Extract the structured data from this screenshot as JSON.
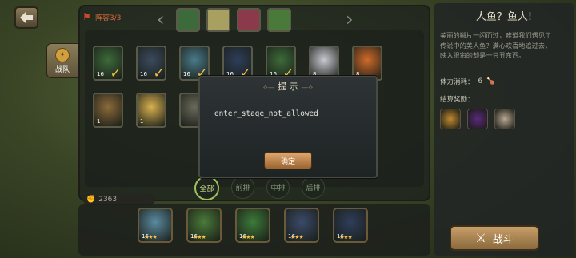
{
  "header": {
    "formation_label": "阵容3/3",
    "prev_icon": "chevron-left-icon",
    "next_icon": "chevron-right-icon"
  },
  "team_tab": {
    "label": "战队"
  },
  "hero_grid": {
    "row1": [
      {
        "level": "16",
        "selected": true,
        "color": "#3d6a3a"
      },
      {
        "level": "16",
        "selected": true,
        "color": "#3a4a5e"
      },
      {
        "level": "16",
        "selected": true,
        "color": "#4a7a8a"
      },
      {
        "level": "16",
        "selected": true,
        "color": "#2e3e5a"
      },
      {
        "level": "16",
        "selected": true,
        "color": "#3d6a3a"
      },
      {
        "level": "8",
        "selected": false,
        "color": "#c8c8d0"
      },
      {
        "level": "8",
        "selected": false,
        "color": "#d06a2a"
      }
    ],
    "row2": [
      {
        "level": "1",
        "selected": false,
        "color": "#8a6a3a"
      },
      {
        "level": "1",
        "selected": false,
        "color": "#d8b050"
      },
      {
        "level": "",
        "selected": false,
        "color": "#6a6a5a"
      }
    ]
  },
  "filters": [
    {
      "label": "全部",
      "active": true
    },
    {
      "label": "前排",
      "active": false
    },
    {
      "label": "中排",
      "active": false
    },
    {
      "label": "后排",
      "active": false
    }
  ],
  "power": {
    "value": "2363"
  },
  "bottom_team": [
    {
      "level": "16",
      "color": "#5a8aa0"
    },
    {
      "level": "16",
      "color": "#4a7a3a"
    },
    {
      "level": "16",
      "color": "#3d7a3a"
    },
    {
      "level": "16",
      "color": "#3a4a6a"
    },
    {
      "level": "16",
      "color": "#2e3e5a"
    }
  ],
  "stage": {
    "title": "人鱼？鱼人!",
    "description": "美丽的鳞片一闪而过，难道我们遇见了传说中的美人鱼？满心欢喜地追过去，映入眼帘的却是一只丑东西。",
    "stamina_label": "体力消耗：",
    "stamina_value": "6",
    "reward_label": "结算奖励：",
    "rewards": [
      {
        "color": "#c08a30"
      },
      {
        "color": "#5a2a7a"
      },
      {
        "color": "#b8a890"
      }
    ],
    "fight_label": "战斗"
  },
  "dialog": {
    "title": "提 示",
    "message": "enter_stage_not_allowed",
    "confirm_label": "确定"
  }
}
